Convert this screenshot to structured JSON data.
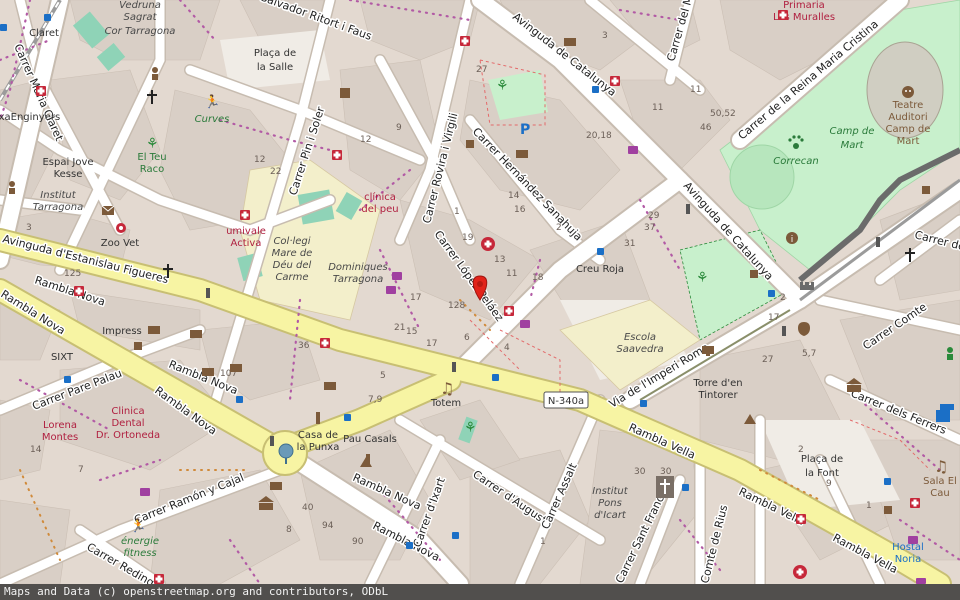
{
  "colors": {
    "land": "#e3d9d0",
    "building": "#d9cfc6",
    "park": "#c8f0cc",
    "square": "#f4efe9",
    "primary_road": "#f7f4a3",
    "primary_casing": "#c8bf73",
    "minor_road": "#ffffff",
    "casing": "#c7bcb0",
    "amenity_red": "#c6283a",
    "amenity_brown": "#7c5a3a",
    "green_icon": "#2a8a3a",
    "blue_label": "#1b6fc6",
    "magenta_label": "#b02040",
    "marker_red": "#e2231a"
  },
  "roads": {
    "avinguda_estanislau": "Avinguda d'Estanislau Figueres",
    "avinguda_catalunya_top": "Avinguda de Catalunya",
    "avinguda_catalunya_mid": "Avinguda de Catalunya",
    "reina_maria_cristina": "Carrer de la Reina Maria Cristina",
    "rambla_nova_1": "Rambla Nova",
    "rambla_nova_2": "Rambla Nova",
    "rambla_nova_3": "Rambla Nova",
    "rambla_nova_4": "Rambla Nova",
    "rambla_nova_5": "Rambla Nova",
    "rambla_nova_6": "Rambla Nova",
    "rambla_vella_1": "Rambla Vella",
    "rambla_vella_2": "Rambla Vella",
    "rambla_vella_3": "Rambla Vella",
    "via_imperi_roma": "Via de l'Imperi Roma",
    "n340a": "N-340a",
    "pin_soler": "Carrer Pin i Soler",
    "rovira_virgili": "Carrer Rovira i Virgili",
    "hernandez_sanahuja": "Carrer Hernández Sanahuja",
    "lopez_pelaez": "Carrer López Peláez",
    "salvador_ritort": "Salvador Ritort i Faus",
    "carrer_del_mo": "Carrer del Mo",
    "maria_claret": "Carrer Maria Claret",
    "pare_palau": "Carrer Pare Palau",
    "ramon_cajal": "Carrer Ramón y Cajal",
    "reding": "Carrer Reding",
    "ixart": "Carrer d'Ixart",
    "august": "Carrer d'August",
    "assalt": "Carrer Assalt",
    "sant_frances": "Carrer Sant Francesc",
    "comte_rius": "Comte de Rius",
    "comte": "Carrer Comte",
    "ferrers": "Carrer dels Ferrers",
    "carrer_de_edge": "Carrer de"
  },
  "places": {
    "vedruna": [
      "Vedruna",
      "Sagrat",
      "Cor Tarragona"
    ],
    "placa_salle": [
      "Plaça de",
      "la Salle"
    ],
    "primaria": [
      "Primaria",
      "Les Muralles"
    ],
    "teatre": [
      "Teatre",
      "Auditori",
      "Camp de",
      "Mart"
    ],
    "camp_mart": [
      "Camp de",
      "Mart"
    ],
    "correcan": "Correcan",
    "claret": "Claret",
    "enginyers": "ixaEnginyers",
    "espai_jove": [
      "Espai Jove",
      "Kesse"
    ],
    "institut_tarragona": [
      "Institut",
      "Tarragona"
    ],
    "el_teu_raco": [
      "El Teu",
      "Raco"
    ],
    "curves": "Curves",
    "zoo_vet": "Zoo Vet",
    "umivale": [
      "umivale",
      "Activa"
    ],
    "collegi": [
      "Col·legi",
      "Mare de",
      "Déu del",
      "Carme"
    ],
    "dominiques": [
      "Dominiques",
      "Tarragona"
    ],
    "clinica_peu": [
      "clínica",
      "del peu"
    ],
    "creu_roja": "Creu Roja",
    "escola_saavedra": [
      "Escola",
      "Saavedra"
    ],
    "impress": "Impress",
    "sixt": "SIXT",
    "lorena": [
      "Lorena",
      "Montes"
    ],
    "clinica_dental": [
      "Clinica",
      "Dental",
      "Dr. Ortoneda"
    ],
    "casa_punxa": [
      "Casa de",
      "la Punxa"
    ],
    "pau_casals": "Pau Casals",
    "totem": "Totem",
    "torre_tintorer": [
      "Torre d'en",
      "Tintorer"
    ],
    "placa_font": [
      "Plaça de",
      "la Font"
    ],
    "sala_cau": [
      "Sala El",
      "Cau"
    ],
    "institut_pons": [
      "Institut",
      "Pons",
      "d'Icart"
    ],
    "energie": [
      "énergie",
      "fitness"
    ],
    "hostal_noria": [
      "Hostal",
      "Noria"
    ]
  },
  "numbers": [
    "3",
    "11",
    "20,18",
    "9",
    "27",
    "12",
    "22",
    "1",
    "14",
    "16",
    "19",
    "13",
    "17",
    "18",
    "11",
    "128",
    "125",
    "107",
    "36",
    "7,9",
    "5",
    "6",
    "17",
    "15",
    "4",
    "2",
    "21",
    "31",
    "37",
    "46",
    "50,52",
    "11",
    "29",
    "30",
    "1",
    "40",
    "94",
    "90",
    "8",
    "3",
    "5,7",
    "27",
    "17",
    "2",
    "30",
    "9",
    "1",
    "2",
    "14",
    "7",
    "12"
  ],
  "footer": {
    "attribution": "Maps and Data (c) openstreetmap.org and contributors, ODbL"
  }
}
